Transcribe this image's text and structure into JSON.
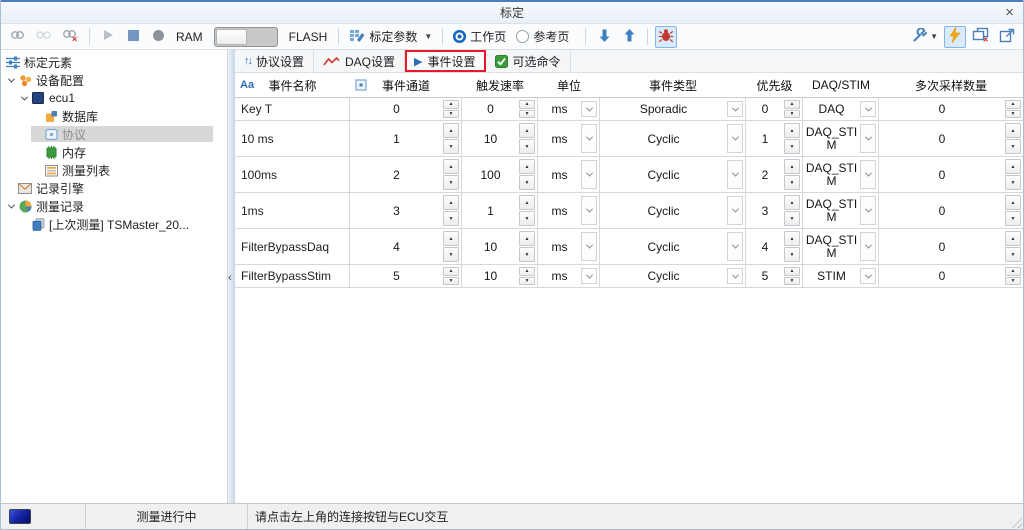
{
  "window": {
    "title": "标定",
    "close_glyph": "×"
  },
  "toolbar": {
    "ram_label": "RAM",
    "flash_label": "FLASH",
    "calib_params_label": "标定参数",
    "work_page_label": "工作页",
    "ref_page_label": "参考页",
    "work_page_selected": true,
    "ref_page_selected": false
  },
  "sidebar": {
    "items": [
      {
        "id": "calibration-elements",
        "label": "标定元素",
        "icon": "sliders-icon",
        "depth": 0
      },
      {
        "id": "device-config",
        "label": "设备配置",
        "icon": "device-config-icon",
        "depth": 0,
        "expander": true
      },
      {
        "id": "ecu1",
        "label": "ecu1",
        "icon": "ecu-icon",
        "depth": 1,
        "expander": true
      },
      {
        "id": "database",
        "label": "数据库",
        "icon": "database-icon",
        "depth": 2,
        "expander": false
      },
      {
        "id": "protocol",
        "label": "协议",
        "icon": "protocol-icon",
        "depth": 2,
        "expander": false,
        "selected": true,
        "dim": true
      },
      {
        "id": "memory",
        "label": "内存",
        "icon": "memory-icon",
        "depth": 2,
        "expander": false
      },
      {
        "id": "measure-list",
        "label": "测量列表",
        "icon": "measure-list-icon",
        "depth": 2,
        "expander": false
      },
      {
        "id": "record-engine",
        "label": "记录引擎",
        "icon": "record-engine-icon",
        "depth": 0,
        "expander": false
      },
      {
        "id": "measure-record",
        "label": "测量记录",
        "icon": "measure-record-icon",
        "depth": 0,
        "expander": true
      },
      {
        "id": "last-measurement",
        "label": "[上次测量] TSMaster_20...",
        "icon": "measurement-file-icon",
        "depth": 1,
        "expander": false
      }
    ]
  },
  "tabs": [
    {
      "id": "protocol-settings",
      "label": "协议设置",
      "icon": "sort-arrows-icon"
    },
    {
      "id": "daq-settings",
      "label": "DAQ设置",
      "icon": "waveform-icon"
    },
    {
      "id": "event-settings",
      "label": "事件设置",
      "icon": "play-icon",
      "annotated": true
    },
    {
      "id": "optional-commands",
      "label": "可选命令",
      "icon": "checkbox-icon"
    }
  ],
  "table": {
    "columns": [
      "事件名称",
      "事件通道",
      "触发速率",
      "单位",
      "事件类型",
      "优先级",
      "DAQ/STIM",
      "多次采样数量"
    ],
    "rows": [
      {
        "name": "Key T",
        "channel": "0",
        "rate": "0",
        "unit": "ms",
        "type": "Sporadic",
        "priority": "0",
        "daq_stim": "DAQ",
        "samples": "0"
      },
      {
        "name": "10 ms",
        "channel": "1",
        "rate": "10",
        "unit": "ms",
        "type": "Cyclic",
        "priority": "1",
        "daq_stim": "DAQ_STIM",
        "samples": "0"
      },
      {
        "name": "100ms",
        "channel": "2",
        "rate": "100",
        "unit": "ms",
        "type": "Cyclic",
        "priority": "2",
        "daq_stim": "DAQ_STIM",
        "samples": "0"
      },
      {
        "name": "1ms",
        "channel": "3",
        "rate": "1",
        "unit": "ms",
        "type": "Cyclic",
        "priority": "3",
        "daq_stim": "DAQ_STIM",
        "samples": "0"
      },
      {
        "name": "FilterBypassDaq",
        "channel": "4",
        "rate": "10",
        "unit": "ms",
        "type": "Cyclic",
        "priority": "4",
        "daq_stim": "DAQ_STIM",
        "samples": "0"
      },
      {
        "name": "FilterBypassStim",
        "channel": "5",
        "rate": "10",
        "unit": "ms",
        "type": "Cyclic",
        "priority": "5",
        "daq_stim": "STIM",
        "samples": "0"
      }
    ]
  },
  "statusbar": {
    "measurement_status": "测量进行中",
    "hint": "请点击左上角的连接按钮与ECU交互"
  },
  "colors": {
    "accent_blue": "#2e6fb5",
    "annotation_red": "#e8192c",
    "bug_red": "#c23b2f",
    "lightning_orange": "#f6a90f",
    "pressed_bg": "#d9eafb",
    "tree_selected_bg": "#d8d8d8"
  }
}
